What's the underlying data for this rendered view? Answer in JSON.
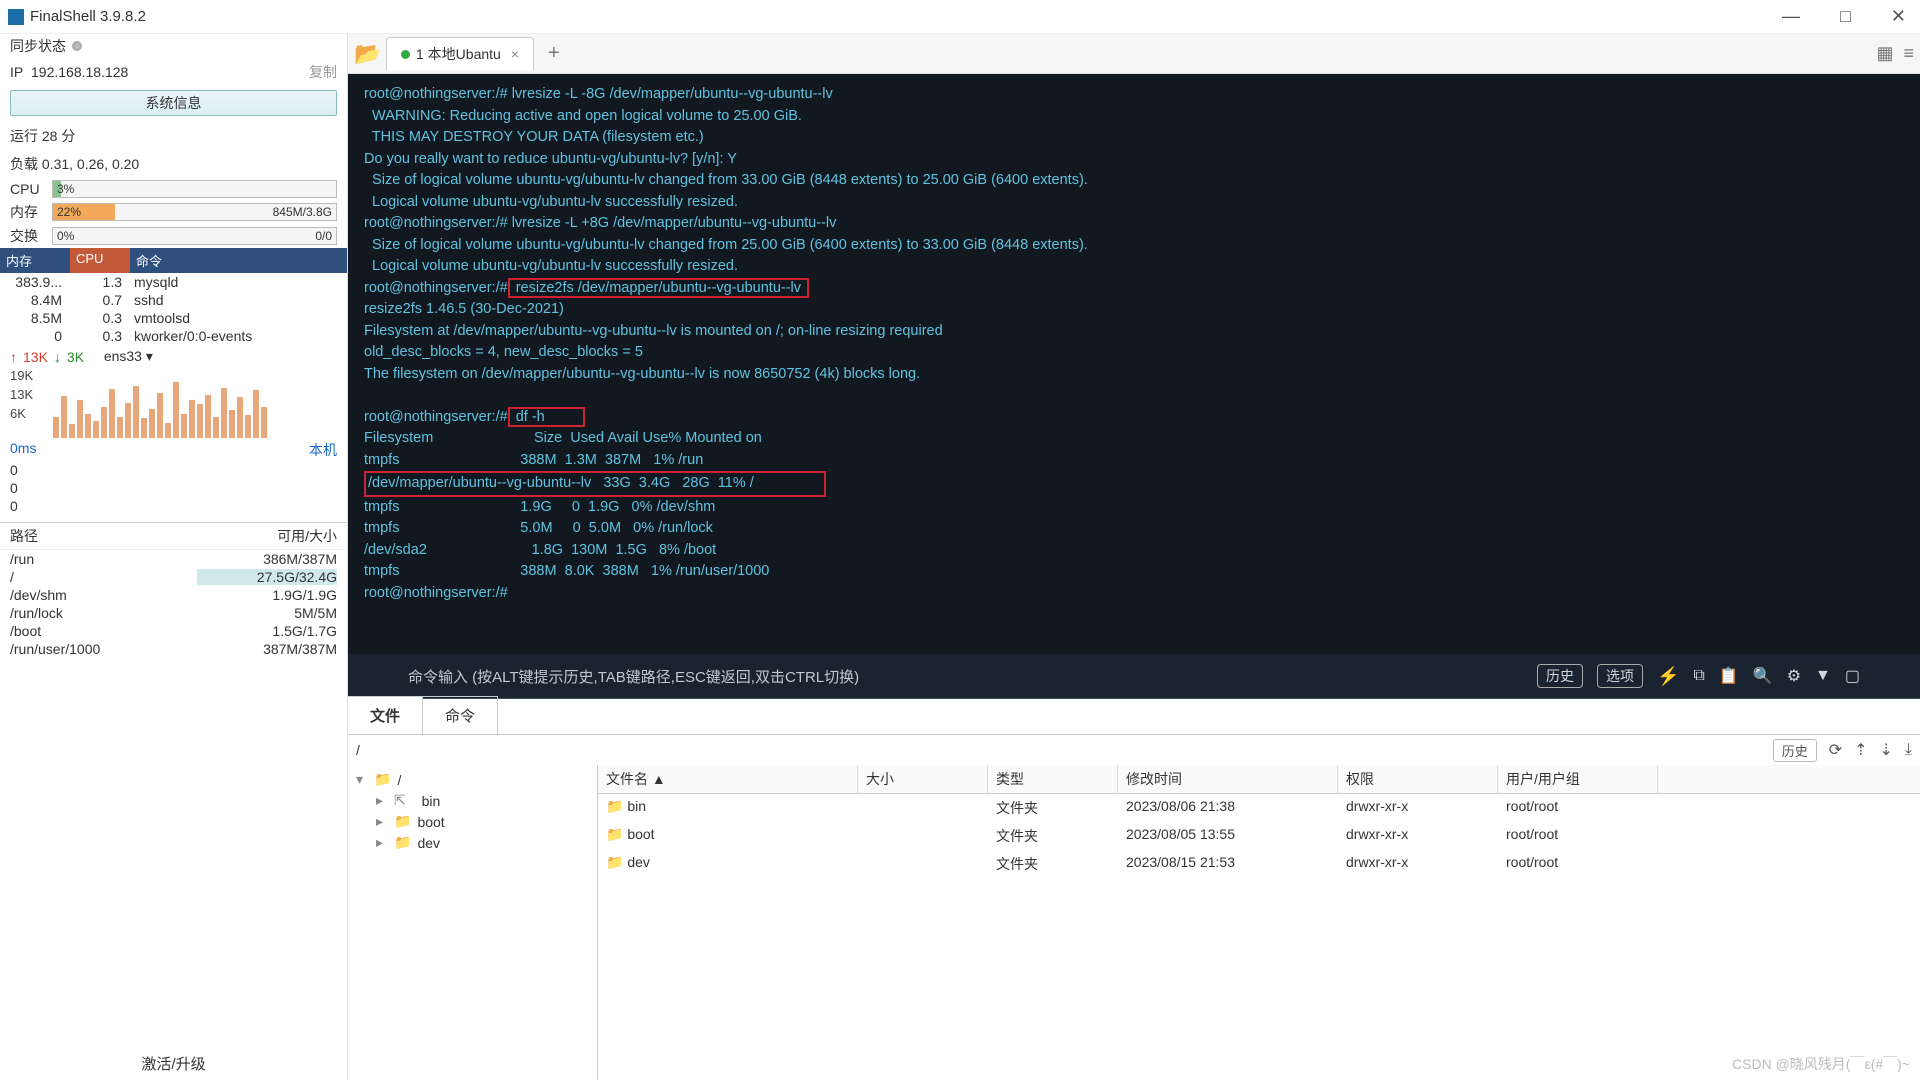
{
  "titlebar": {
    "title": "FinalShell 3.9.8.2"
  },
  "sidebar": {
    "sync_label": "同步状态",
    "ip_label": "IP",
    "ip_value": "192.168.18.128",
    "copy_label": "复制",
    "sysinfo_btn": "系统信息",
    "uptime": "运行 28 分",
    "load_label": "负载 0.31, 0.26, 0.20",
    "cpu_label": "CPU",
    "cpu_pct": "3%",
    "mem_label": "内存",
    "mem_pct": "22%",
    "mem_rt": "845M/3.8G",
    "swap_label": "交换",
    "swap_pct": "0%",
    "swap_rt": "0/0",
    "proc_head": {
      "c1": "内存",
      "c2": "CPU",
      "c3": "命令"
    },
    "procs": [
      {
        "mem": "383.9...",
        "cpu": "1.3",
        "cmd": "mysqld"
      },
      {
        "mem": "8.4M",
        "cpu": "0.7",
        "cmd": "sshd"
      },
      {
        "mem": "8.5M",
        "cpu": "0.3",
        "cmd": "vmtoolsd"
      },
      {
        "mem": "0",
        "cpu": "0.3",
        "cmd": "kworker/0:0-events"
      }
    ],
    "net_up": "13K",
    "net_dn": "3K",
    "iface": "ens33",
    "ticks": [
      "19K",
      "13K",
      "6K"
    ],
    "lat_ms": "0ms",
    "lat_host": "本机",
    "lat_vals": [
      "0",
      "0",
      "0"
    ],
    "disk_head": {
      "path": "路径",
      "size": "可用/大小"
    },
    "disks": [
      {
        "path": "/run",
        "size": "386M/387M",
        "hl": false
      },
      {
        "path": "/",
        "size": "27.5G/32.4G",
        "hl": true
      },
      {
        "path": "/dev/shm",
        "size": "1.9G/1.9G",
        "hl": false
      },
      {
        "path": "/run/lock",
        "size": "5M/5M",
        "hl": false
      },
      {
        "path": "/boot",
        "size": "1.5G/1.7G",
        "hl": false
      },
      {
        "path": "/run/user/1000",
        "size": "387M/387M",
        "hl": false
      }
    ],
    "activate": "激活/升级"
  },
  "tabs": {
    "t0": "1 本地Ubantu"
  },
  "terminal": {
    "l1": "root@nothingserver:/# lvresize -L -8G /dev/mapper/ubuntu--vg-ubuntu--lv",
    "l2": "  WARNING: Reducing active and open logical volume to 25.00 GiB.",
    "l3": "  THIS MAY DESTROY YOUR DATA (filesystem etc.)",
    "l4": "Do you really want to reduce ubuntu-vg/ubuntu-lv? [y/n]: Y",
    "l5": "  Size of logical volume ubuntu-vg/ubuntu-lv changed from 33.00 GiB (8448 extents) to 25.00 GiB (6400 extents).",
    "l6": "  Logical volume ubuntu-vg/ubuntu-lv successfully resized.",
    "l7": "root@nothingserver:/# lvresize -L +8G /dev/mapper/ubuntu--vg-ubuntu--lv",
    "l8": "  Size of logical volume ubuntu-vg/ubuntu-lv changed from 25.00 GiB (6400 extents) to 33.00 GiB (8448 extents).",
    "l9": "  Logical volume ubuntu-vg/ubuntu-lv successfully resized.",
    "l10a": "root@nothingserver:/#",
    "l10b": " resize2fs /dev/mapper/ubuntu--vg-ubuntu--lv ",
    "l11": "resize2fs 1.46.5 (30-Dec-2021)",
    "l12": "Filesystem at /dev/mapper/ubuntu--vg-ubuntu--lv is mounted on /; on-line resizing required",
    "l13": "old_desc_blocks = 4, new_desc_blocks = 5",
    "l14": "The filesystem on /dev/mapper/ubuntu--vg-ubuntu--lv is now 8650752 (4k) blocks long.",
    "l15": "",
    "l16a": "root@nothingserver:/#",
    "l16b": " df -h         ",
    "l17": "Filesystem                         Size  Used Avail Use% Mounted on",
    "l18": "tmpfs                              388M  1.3M  387M   1% /run",
    "l19": "/dev/mapper/ubuntu--vg-ubuntu--lv   33G  3.4G   28G  11% /                 ",
    "l20": "tmpfs                              1.9G     0  1.9G   0% /dev/shm",
    "l21": "tmpfs                              5.0M     0  5.0M   0% /run/lock",
    "l22": "/dev/sda2                          1.8G  130M  1.5G   8% /boot",
    "l23": "tmpfs                              388M  8.0K  388M   1% /run/user/1000",
    "l24": "root@nothingserver:/#"
  },
  "cmdbar": {
    "hint": "命令输入 (按ALT键提示历史,TAB键路径,ESC键返回,双击CTRL切换)",
    "history": "历史",
    "options": "选项"
  },
  "lower": {
    "tab_file": "文件",
    "tab_cmd": "命令",
    "path": "/",
    "history_btn": "历史",
    "tree": {
      "root": "/",
      "items": [
        "bin",
        "boot",
        "dev"
      ]
    },
    "cols": {
      "name": "文件名",
      "size": "大小",
      "type": "类型",
      "time": "修改时间",
      "perm": "权限",
      "user": "用户/用户组"
    },
    "sort_arrow": "▲",
    "rows": [
      {
        "name": "bin",
        "size": "",
        "type": "文件夹",
        "time": "2023/08/06 21:38",
        "perm": "drwxr-xr-x",
        "user": "root/root"
      },
      {
        "name": "boot",
        "size": "",
        "type": "文件夹",
        "time": "2023/08/05 13:55",
        "perm": "drwxr-xr-x",
        "user": "root/root"
      },
      {
        "name": "dev",
        "size": "",
        "type": "文件夹",
        "time": "2023/08/15 21:53",
        "perm": "drwxr-xr-x",
        "user": "root/root"
      }
    ]
  },
  "watermark": "CSDN @晓风残月(￣ε(#￣)~"
}
